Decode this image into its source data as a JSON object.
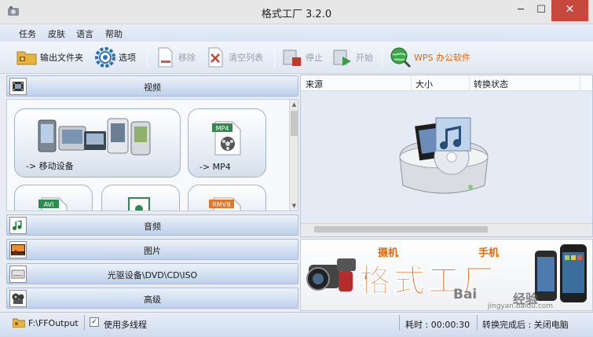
{
  "window": {
    "title": "格式工厂 3.2.0",
    "minimize_glyph": "─",
    "maximize_glyph": "☐",
    "close_glyph": "✕"
  },
  "menu": [
    "任务",
    "皮肤",
    "语言",
    "帮助"
  ],
  "toolbar": {
    "output_folder": "输出文件夹",
    "options": "选项",
    "remove": "移除",
    "clear_list": "清空列表",
    "stop": "停止",
    "start": "开始",
    "wps": "WPS 办公软件"
  },
  "categories": {
    "video": "视频",
    "audio": "音频",
    "image": "图片",
    "optical": "光驱设备\\DVD\\CD\\ISO",
    "advanced": "高级"
  },
  "video_tiles": {
    "mobile": "-> 移动设备",
    "mp4": "-> MP4",
    "mp4_badge": "MP4",
    "avi_badge": "AVI",
    "rmvb_badge": "RMVB"
  },
  "file_table": {
    "columns": [
      "来源",
      "大小",
      "转换状态"
    ]
  },
  "banner": {
    "brand": "格式工厂",
    "camera_label": "摄机",
    "phone_label": "手机",
    "watermark": "Bai",
    "watermark_cn": "经验",
    "watermark_url": "jingyan.baidu.com"
  },
  "status": {
    "output_path": "F:\\FFOutput",
    "multithread": "使用多线程",
    "multithread_checked": true,
    "elapsed": "耗时 : 00:00:30",
    "after_convert": "转换完成后 : 关闭电脑"
  },
  "colors": {
    "accent_orange": "#e06a0b",
    "close_red": "#c7493e",
    "category_blue": "#bdd0ea"
  }
}
